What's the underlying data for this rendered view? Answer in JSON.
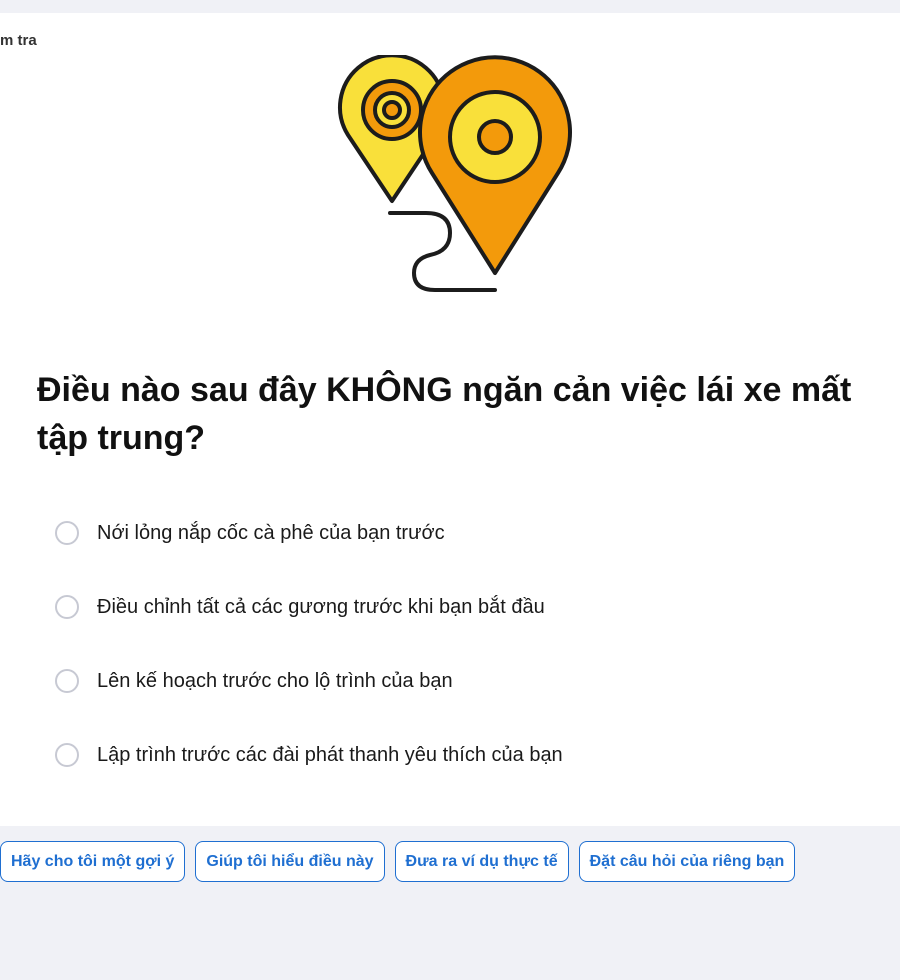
{
  "breadcrumb": "m tra",
  "illustration": {
    "name": "map-pins-route",
    "colors": {
      "yellow": "#f9e03a",
      "orange": "#f39a0b",
      "outline": "#1c1c1c"
    }
  },
  "question": "Điều nào sau đây KHÔNG ngăn cản việc lái xe mất tập trung?",
  "options": [
    "Nới lỏng nắp cốc cà phê của bạn trước",
    "Điều chỉnh tất cả các gương trước khi bạn bắt đầu",
    "Lên kế hoạch trước cho lộ trình của bạn",
    "Lập trình trước các đài phát thanh yêu thích của bạn"
  ],
  "chips": [
    "Hãy cho tôi một gợi ý",
    "Giúp tôi hiểu điều này",
    "Đưa ra ví dụ thực tế",
    "Đặt câu hỏi của riêng bạn"
  ],
  "accent_color": "#1f6fd1"
}
